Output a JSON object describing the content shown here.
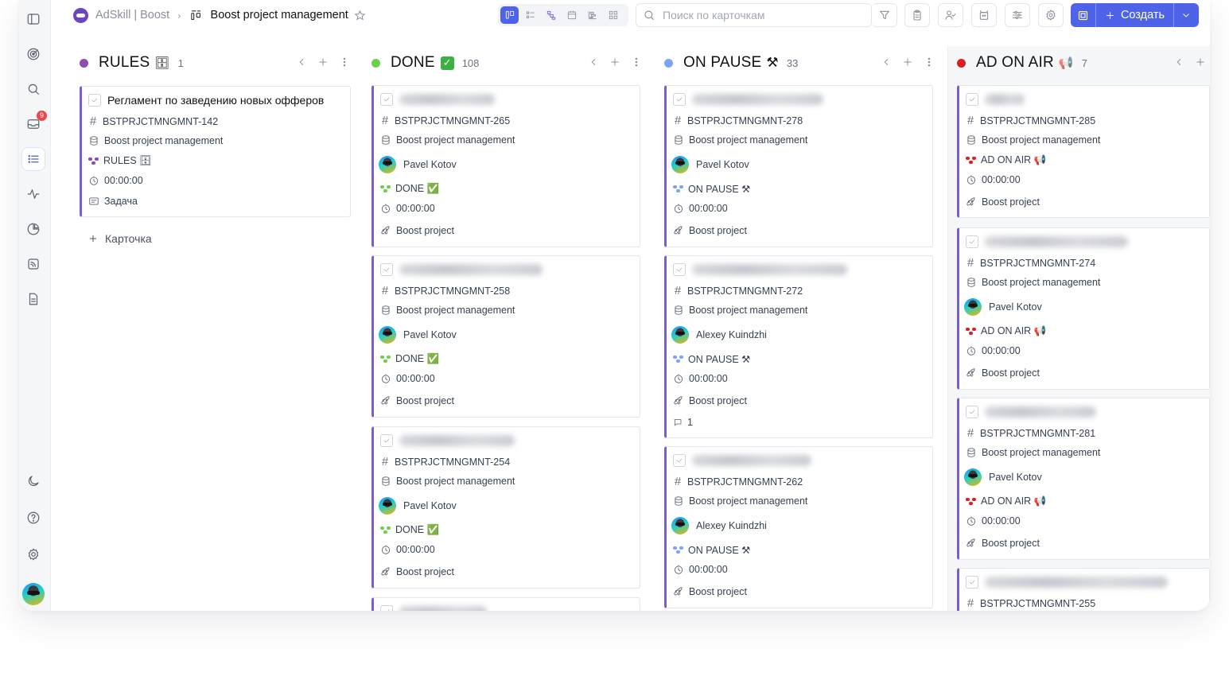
{
  "breadcrumb": {
    "workspace": "AdSkill",
    "space": "Boost",
    "board_title": "Boost project management"
  },
  "sidebar": {
    "inbox_badge": "9"
  },
  "search": {
    "placeholder": "Поиск по карточкам"
  },
  "toolbar": {
    "create_label": "Создать"
  },
  "columns": [
    {
      "title": "RULES",
      "emoji": "🗄",
      "count": "1",
      "color": "#8e4bb0",
      "cards": [
        {
          "title": "Регламент по заведению новых офферов",
          "id": "BSTPRJCTMNGMNT-142",
          "project": "Boost project management",
          "status": "RULES 🗄",
          "time": "00:00:00",
          "type": "Задача"
        }
      ],
      "add_label": "Карточка"
    },
    {
      "title": "DONE",
      "emoji": "✅",
      "count": "108",
      "color": "#6bd04a",
      "cards": [
        {
          "id": "BSTPRJCTMNGMNT-265",
          "project": "Boost project management",
          "assignee": "Pavel Kotov",
          "status": "DONE ✅",
          "time": "00:00:00",
          "tag": "Boost project"
        },
        {
          "id": "BSTPRJCTMNGMNT-258",
          "project": "Boost project management",
          "assignee": "Pavel Kotov",
          "status": "DONE ✅",
          "time": "00:00:00",
          "tag": "Boost project"
        },
        {
          "id": "BSTPRJCTMNGMNT-254",
          "project": "Boost project management",
          "assignee": "Pavel Kotov",
          "status": "DONE ✅",
          "time": "00:00:00",
          "tag": "Boost project"
        }
      ]
    },
    {
      "title": "ON PAUSE",
      "emoji": "⚒",
      "count": "33",
      "color": "#7ba4f2",
      "cards": [
        {
          "id": "BSTPRJCTMNGMNT-278",
          "project": "Boost project management",
          "assignee": "Pavel Kotov",
          "status": "ON PAUSE ⚒",
          "time": "00:00:00",
          "tag": "Boost project"
        },
        {
          "id": "BSTPRJCTMNGMNT-272",
          "project": "Boost project management",
          "assignee": "Alexey Kuindzhi",
          "status": "ON PAUSE ⚒",
          "time": "00:00:00",
          "tag": "Boost project",
          "comments": "1"
        },
        {
          "id": "BSTPRJCTMNGMNT-262",
          "project": "Boost project management",
          "assignee": "Alexey Kuindzhi",
          "status": "ON PAUSE ⚒",
          "time": "00:00:00",
          "tag": "Boost project"
        }
      ]
    },
    {
      "title": "AD ON AIR",
      "emoji": "📢",
      "count": "7",
      "color": "#d91f26",
      "cards": [
        {
          "id": "BSTPRJCTMNGMNT-285",
          "project": "Boost project management",
          "status": "AD ON AIR 📢",
          "time": "00:00:00",
          "tag": "Boost project"
        },
        {
          "id": "BSTPRJCTMNGMNT-274",
          "project": "Boost project management",
          "assignee": "Pavel Kotov",
          "status": "AD ON AIR 📢",
          "time": "00:00:00",
          "tag": "Boost project"
        },
        {
          "id": "BSTPRJCTMNGMNT-281",
          "project": "Boost project management",
          "assignee": "Pavel Kotov",
          "status": "AD ON AIR 📢",
          "time": "00:00:00",
          "tag": "Boost project"
        },
        {
          "id": "BSTPRJCTMNGMNT-255"
        }
      ]
    }
  ]
}
